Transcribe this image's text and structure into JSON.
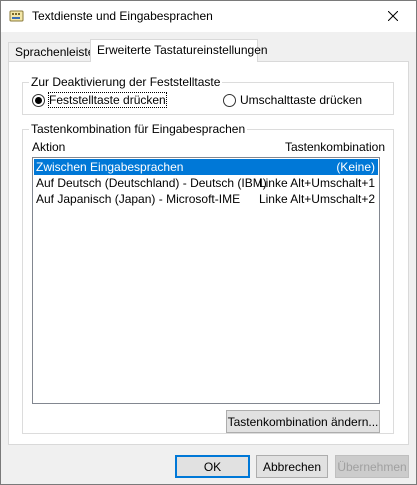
{
  "window": {
    "title": "Textdienste und Eingabesprachen",
    "close_icon": "close-icon"
  },
  "tabs": [
    {
      "label": "Sprachenleiste",
      "active": false
    },
    {
      "label": "Erweiterte Tastatureinstellungen",
      "active": true
    }
  ],
  "capslock_group": {
    "title": "Zur Deaktivierung der Feststelltaste",
    "options": [
      {
        "label": "Feststelltaste drücken",
        "checked": true
      },
      {
        "label": "Umschalttaste drücken",
        "checked": false
      }
    ]
  },
  "hotkeys_group": {
    "title": "Tastenkombination für Eingabesprachen",
    "columns": {
      "action": "Aktion",
      "hotkey": "Tastenkombination"
    },
    "rows": [
      {
        "action": "Zwischen Eingabesprachen",
        "hotkey": "(Keine)",
        "selected": true
      },
      {
        "action": "Auf Deutsch (Deutschland) - Deutsch (IBM)",
        "hotkey": "Linke Alt+Umschalt+1",
        "selected": false
      },
      {
        "action": "Auf Japanisch (Japan) - Microsoft-IME",
        "hotkey": "Linke Alt+Umschalt+2",
        "selected": false
      }
    ],
    "change_button": "Tastenkombination ändern..."
  },
  "footer": {
    "ok": "OK",
    "cancel": "Abbrechen",
    "apply": "Übernehmen"
  },
  "colors": {
    "selection": "#0078d7",
    "default_button_border": "#0078d7"
  }
}
